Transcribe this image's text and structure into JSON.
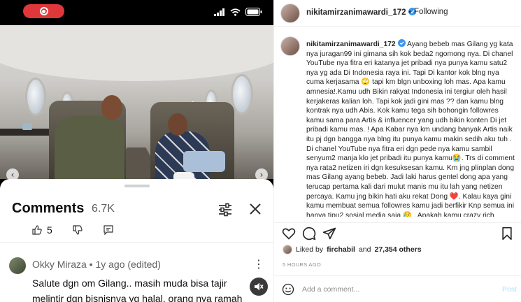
{
  "colors": {
    "recording_red": "#e0373a",
    "instagram_blue": "#0095f6",
    "verified_blue": "#3897f0",
    "post_disabled": "#b2dffc"
  },
  "phone_status": {
    "recording_icon": "record-icon",
    "icons": [
      "signal-icon",
      "wifi-icon",
      "battery-icon"
    ]
  },
  "video": {
    "nav_prev_icon": "chevron-left-icon",
    "nav_next_icon": "chevron-right-icon"
  },
  "comments_sheet": {
    "title": "Comments",
    "count": "6.7K",
    "previous_comment": {
      "like_count": "5"
    },
    "comment": {
      "author_line": "Okky Miraza • 1y ago (edited)",
      "text": "Salute dgn om Gilang.. masih muda bisa tajir melintir dgn bisnisnya yg halal, orang nya ramah"
    }
  },
  "post": {
    "username": "nikitamirzanimawardi_172",
    "separator": "•",
    "follow_label": "Following",
    "caption": "Ayang bebeb mas Gilang yg kata nya juragan99 ini gimana sih kok beda2 ngomong nya. Di chanel YouTube nya fitra eri katanya jet pribadi nya punya kamu satu2 nya yg ada Di Indonesia raya ini. Tapi Di kantor kok blng nya cuma kerjasama 🙄 tapi km blgn unboxing loh mas. Apa kamu amnesia!.Kamu udh Bikin rakyat Indonesia ini tergiur oleh hasil kerjakeras kalian loh. Tapi kok jadi gini mas ?? dan kamu blng kontrak nya udh Abis. Kok kamu tega sih bohongin followres kamu sama para Artis & influencer yang udh bikin konten Di jet pribadi kamu mas. ! Apa Kabar nya km undang banyak Artis naik itu pj dgn bangga nya blng itu punya kamu makin sedih aku tuh . Di chanel YouTube nya fitra eri dgn pede nya kamu sambil senyum2 manja klo jet pribadi itu punya kamu😭. Trs di comment nya rata2 netizen iri dgn kesuksesan kamu. Km jng plinplan dong mas Gilang ayang bebeb. Jadi laki harus gentel dong apa yang terucap pertama kali dari mulut manis mu itu lah yang netizen percaya. Kamu jng bikin hati aku rekat Dong ❤️. Kalau kaya gini kamu membuat semua followres kamu jadi berfikir Knp semua ini hanya tipu2 sosial media saja 😥 . Apakah kamu crazy rich sesungguh nya . Km yang saya tau rich itu ga crazy mas Gilang tapi smart and rich 😏 . Kalau aku",
    "liked_by_prefix": "Liked by",
    "liked_by_user": "firchabil",
    "liked_by_and": "and",
    "likes_count": "27,354 others",
    "time_ago": "5 HOURS AGO",
    "add_comment_placeholder": "Add a comment...",
    "post_label": "Post",
    "action_icons": [
      "heart-icon",
      "comment-icon",
      "share-icon",
      "bookmark-icon"
    ]
  }
}
